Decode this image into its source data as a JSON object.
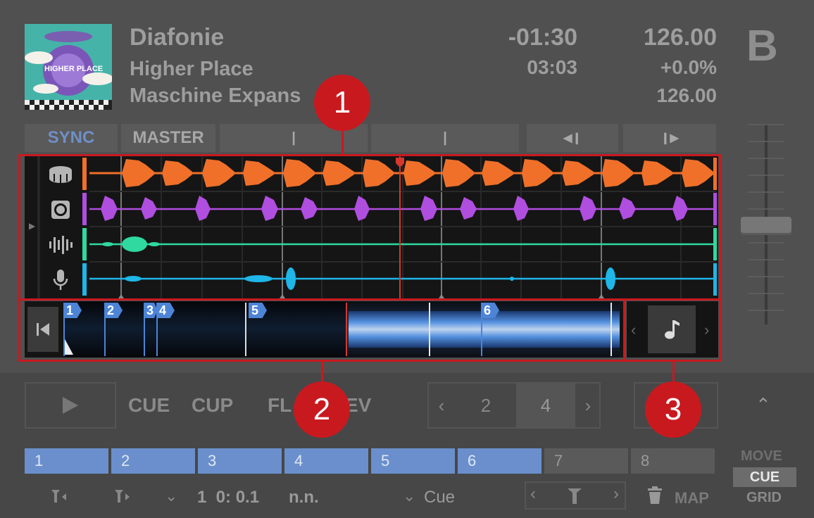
{
  "header": {
    "title": "Diafonie",
    "artist": "Higher Place",
    "album": "Maschine Expans",
    "time_remaining": "-01:30",
    "time_total": "03:03",
    "bpm": "126.00",
    "tempo_offset": "+0.0%",
    "original_bpm": "126.00",
    "deck_letter": "B",
    "artwork_text": "HIGHER PLACE"
  },
  "buttons": {
    "sync": "SYNC",
    "master": "MASTER",
    "beatjump_back": "◀❙",
    "beatjump_fwd": "❙▶"
  },
  "stems": [
    {
      "icon": "drum-icon",
      "color": "#f0702a"
    },
    {
      "icon": "speaker-icon",
      "color": "#b04ee0"
    },
    {
      "icon": "equalizer-icon",
      "color": "#2fd9a0"
    },
    {
      "icon": "microphone-icon",
      "color": "#1fb6e8"
    }
  ],
  "overview": {
    "cue_markers": [
      "1",
      "2",
      "3",
      "4",
      "5",
      "6"
    ]
  },
  "transport": {
    "cue": "CUE",
    "cup": "CUP",
    "flux": "FL",
    "rev": "EV",
    "loop_left": "2",
    "loop_right": "4"
  },
  "hotcues": [
    "1",
    "2",
    "3",
    "4",
    "5",
    "6",
    "7",
    "8"
  ],
  "bottom": {
    "beat_pos": "1  0: 0.1",
    "nn": "n.n.",
    "cue_type": "Cue",
    "map": "MAP",
    "move": "MOVE",
    "cue_mode": "CUE",
    "grid": "GRID"
  },
  "callouts": [
    "1",
    "2",
    "3"
  ],
  "colors": {
    "callout": "#c8191f",
    "sync_blue": "#6a8fcc",
    "hotcue_blue": "#6a8fcc"
  }
}
